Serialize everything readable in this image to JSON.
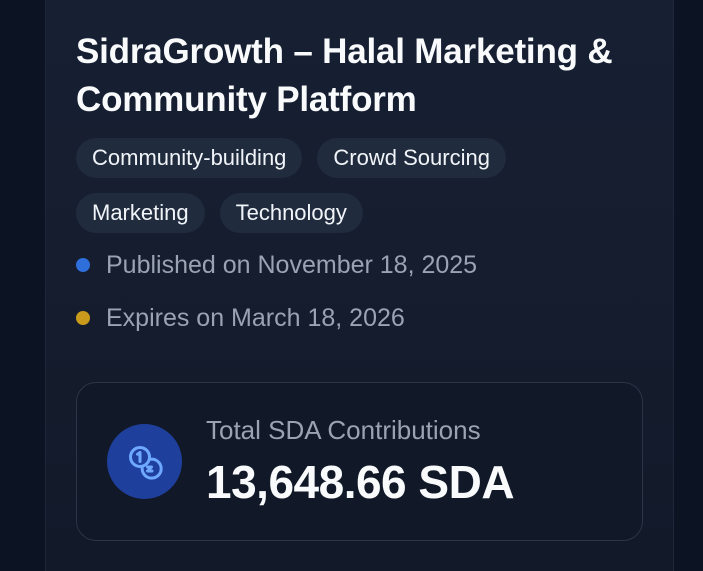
{
  "project": {
    "title": "SidraGrowth – Halal Marketing & Community Platform",
    "tags": [
      "Community-building",
      "Crowd Sourcing",
      "Marketing",
      "Technology"
    ],
    "published": "Published on November 18, 2025",
    "expires": "Expires on March 18, 2026"
  },
  "contributions": {
    "label": "Total SDA Contributions",
    "value": "13,648.66 SDA",
    "icon": "coins-icon"
  },
  "colors": {
    "published_dot": "#2f6fdc",
    "expires_dot": "#c99a1c",
    "icon_badge": "#1f3f9c",
    "icon_stroke": "#6ea8ff"
  }
}
